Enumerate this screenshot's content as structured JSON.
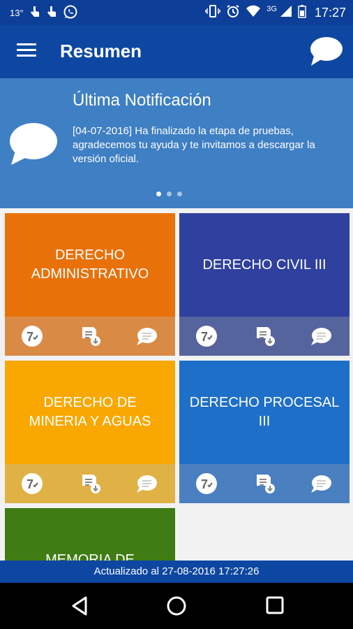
{
  "status_bar": {
    "temperature": "13°",
    "network": "3G",
    "time": "17:27"
  },
  "app_bar": {
    "title": "Resumen"
  },
  "notification": {
    "title": "Última Notificación",
    "text": "[04-07-2016] Ha finalizado la etapa de pruebas, agradecemos tu ayuda y te invitamos a descargar la versión oficial."
  },
  "courses": [
    {
      "name": "DERECHO ADMINISTRATIVO",
      "color": "#e8710a",
      "bar_color": "#d98b46"
    },
    {
      "name": "DERECHO CIVIL III",
      "color": "#30409e",
      "bar_color": "#56649e"
    },
    {
      "name": "DERECHO DE MINERIA Y AGUAS",
      "color": "#f8a800",
      "bar_color": "#e0b145"
    },
    {
      "name": "DERECHO PROCESAL III",
      "color": "#1e6fc8",
      "bar_color": "#4a7fc0"
    },
    {
      "name": "MEMORIA DE",
      "color": "#3f7c14",
      "bar_color": "#3f7c14"
    }
  ],
  "footer": {
    "updated_text": "Actualizado al 27-08-2016 17:27:26"
  }
}
